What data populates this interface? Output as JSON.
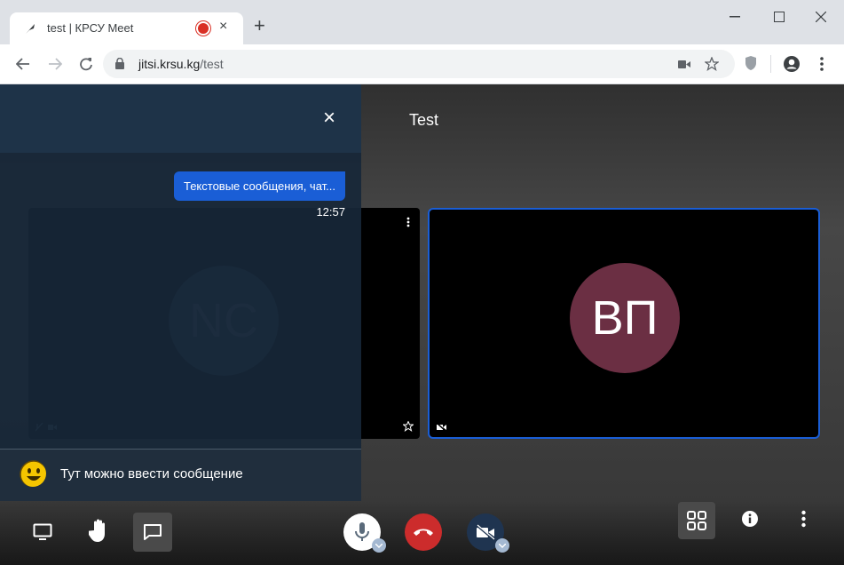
{
  "browser": {
    "tab_title": "test | КРСУ Meet",
    "tab_close": "×",
    "new_tab": "+",
    "url_host": "jitsi.krsu.kg",
    "url_path": "/test"
  },
  "meeting": {
    "title": "Test",
    "participants": [
      {
        "initials": "NC",
        "avatar_color": "#2f3d4b"
      },
      {
        "initials": "ВП",
        "avatar_color": "#6b2f43"
      }
    ]
  },
  "chat": {
    "close": "×",
    "message": {
      "text": "Текстовые сообщения, чат...",
      "time": "12:57"
    },
    "input_value": "Тут можно ввести сообщение"
  },
  "toolbar_icons": [
    "screen-share-icon",
    "raise-hand-icon",
    "chat-icon",
    "microphone-icon",
    "hangup-icon",
    "camera-off-icon",
    "tile-view-icon",
    "info-icon",
    "more-icon"
  ],
  "colors": {
    "accent": "#1a5ed6",
    "hangup": "#cc2c2c",
    "recording": "#d93025"
  }
}
